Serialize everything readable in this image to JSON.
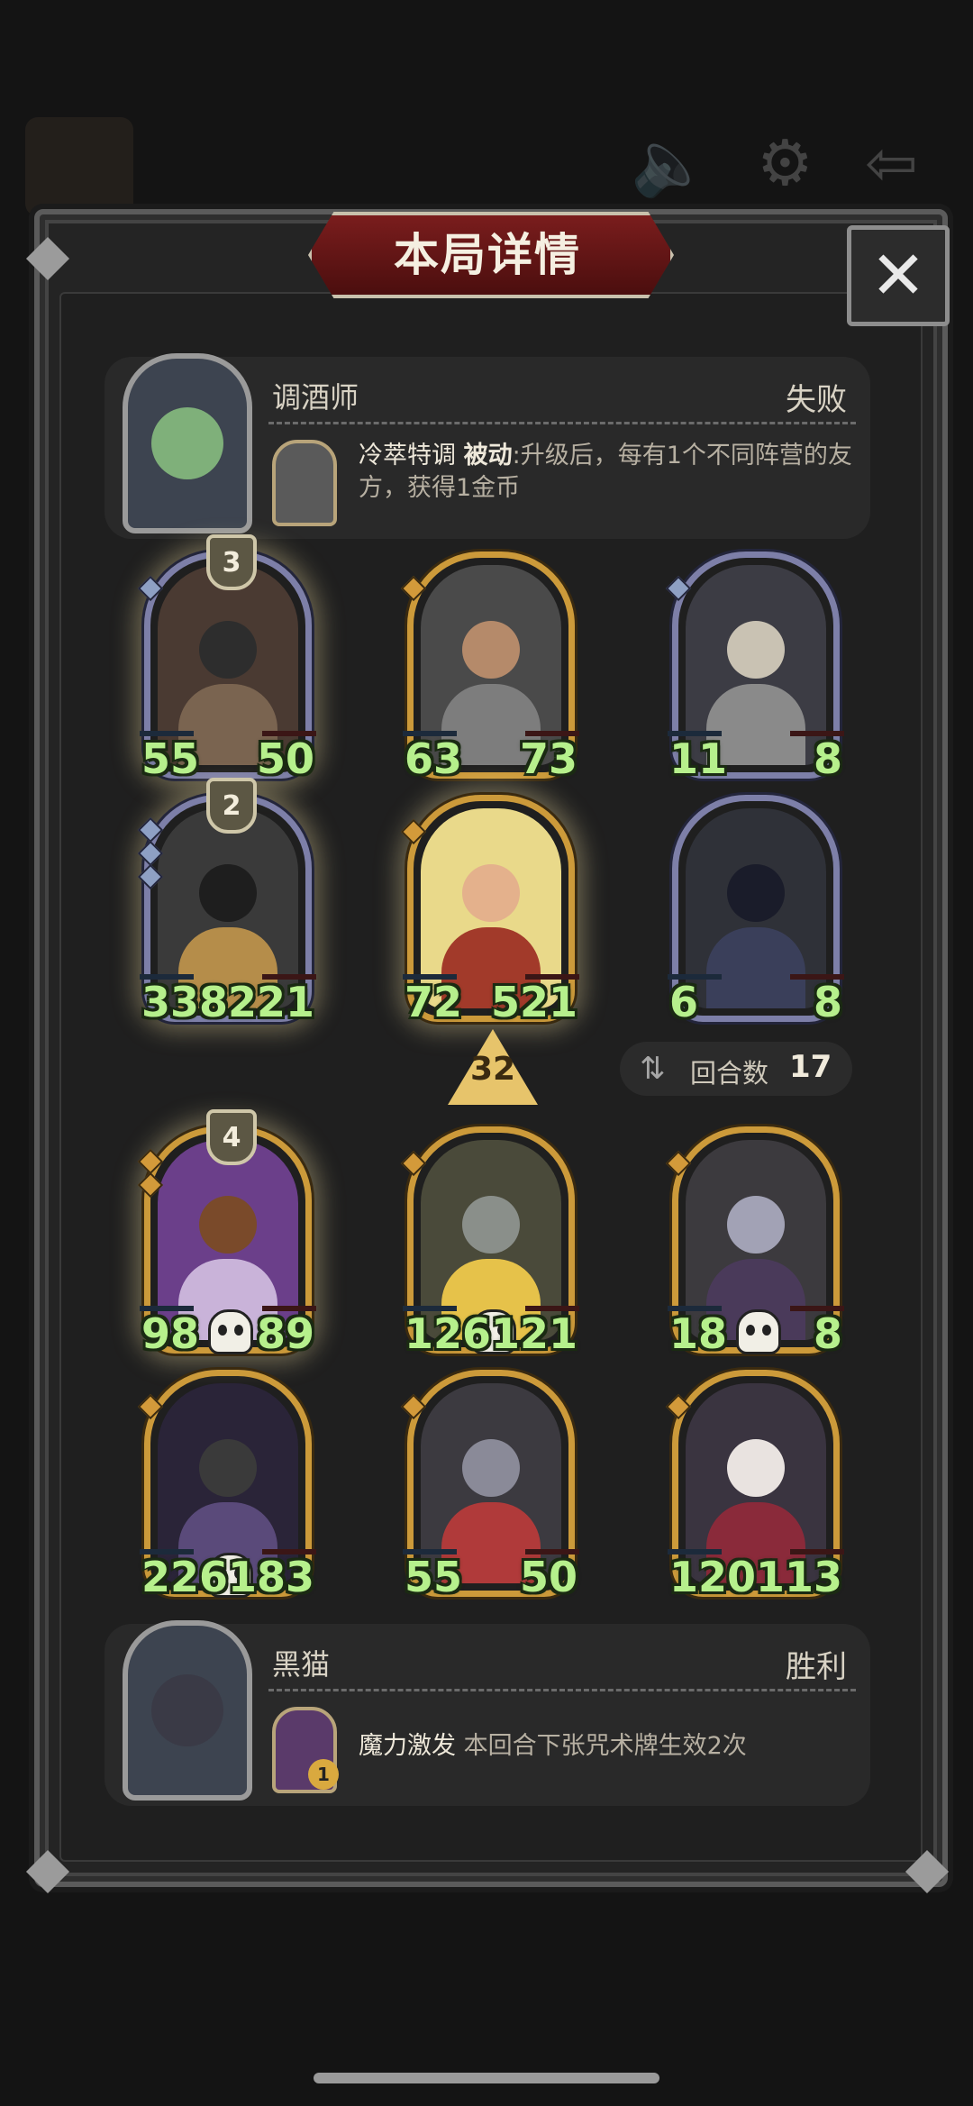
{
  "title": "本局详情",
  "close_icon": "✕",
  "player_top": {
    "name": "调酒师",
    "result": "失败",
    "skill_name": "冷萃特调",
    "skill_keyword": "被动",
    "skill_desc": ":升级后，每有1个不同阵营的友方，获得1金币"
  },
  "player_bottom": {
    "name": "黑猫",
    "result": "胜利",
    "skill_name": "魔力激发",
    "skill_desc": "本回合下张咒术牌生效2次",
    "skill_badge": "1"
  },
  "top_cards": [
    {
      "atk": "55",
      "hp": "50",
      "level": "3"
    },
    {
      "atk": "63",
      "hp": "73"
    },
    {
      "atk": "11",
      "hp": "8"
    },
    {
      "atk": "338",
      "hp": "221",
      "level": "2"
    },
    {
      "atk": "72",
      "hp": "521"
    },
    {
      "atk": "6",
      "hp": "8"
    }
  ],
  "bottom_cards": [
    {
      "atk": "98",
      "hp": "89",
      "level": "4"
    },
    {
      "atk": "126",
      "hp": "121"
    },
    {
      "atk": "18",
      "hp": "8"
    },
    {
      "atk": "226",
      "hp": "183"
    },
    {
      "atk": "55",
      "hp": "50"
    },
    {
      "atk": "120",
      "hp": "113"
    }
  ],
  "upgrade_count": "32",
  "round": {
    "label": "回合数",
    "value": "17"
  },
  "colors": {
    "gold_frame": "#cc9a3a",
    "silver_frame": "#7d7fa8",
    "stat_green": "#b6f08c",
    "banner_red": "#7a1d1d"
  }
}
